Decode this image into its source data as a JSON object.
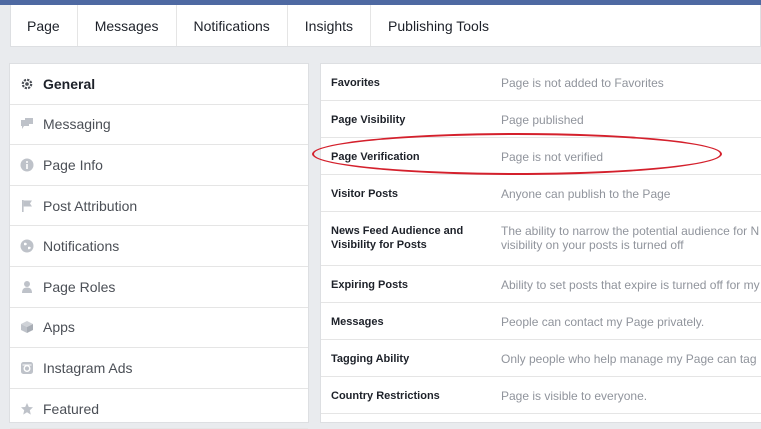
{
  "tabs": [
    "Page",
    "Messages",
    "Notifications",
    "Insights",
    "Publishing Tools"
  ],
  "sidebar": {
    "items": [
      {
        "label": "General",
        "icon": "gear-icon",
        "active": true
      },
      {
        "label": "Messaging",
        "icon": "chat-icon"
      },
      {
        "label": "Page Info",
        "icon": "info-icon"
      },
      {
        "label": "Post Attribution",
        "icon": "flag-icon"
      },
      {
        "label": "Notifications",
        "icon": "globe-icon"
      },
      {
        "label": "Page Roles",
        "icon": "person-icon"
      },
      {
        "label": "Apps",
        "icon": "cube-icon"
      },
      {
        "label": "Instagram Ads",
        "icon": "instagram-icon"
      },
      {
        "label": "Featured",
        "icon": "star-icon"
      }
    ]
  },
  "settings": {
    "rows": [
      {
        "label": "Favorites",
        "value": "Page is not added to Favorites"
      },
      {
        "label": "Page Visibility",
        "value": "Page published"
      },
      {
        "label": "Page Verification",
        "value": "Page is not verified"
      },
      {
        "label": "Visitor Posts",
        "value": "Anyone can publish to the Page"
      },
      {
        "label": "News Feed Audience and Visibility for Posts",
        "value": "The ability to narrow the potential audience for N",
        "value2": "visibility on your posts is turned off"
      },
      {
        "label": "Expiring Posts",
        "value": "Ability to set posts that expire is turned off for my"
      },
      {
        "label": "Messages",
        "value": "People can contact my Page privately."
      },
      {
        "label": "Tagging Ability",
        "value": "Only people who help manage my Page can tag"
      },
      {
        "label": "Country Restrictions",
        "value": "Page is visible to everyone."
      }
    ]
  },
  "colors": {
    "highlight": "#d4202c",
    "topbar": "#4e69a2"
  }
}
